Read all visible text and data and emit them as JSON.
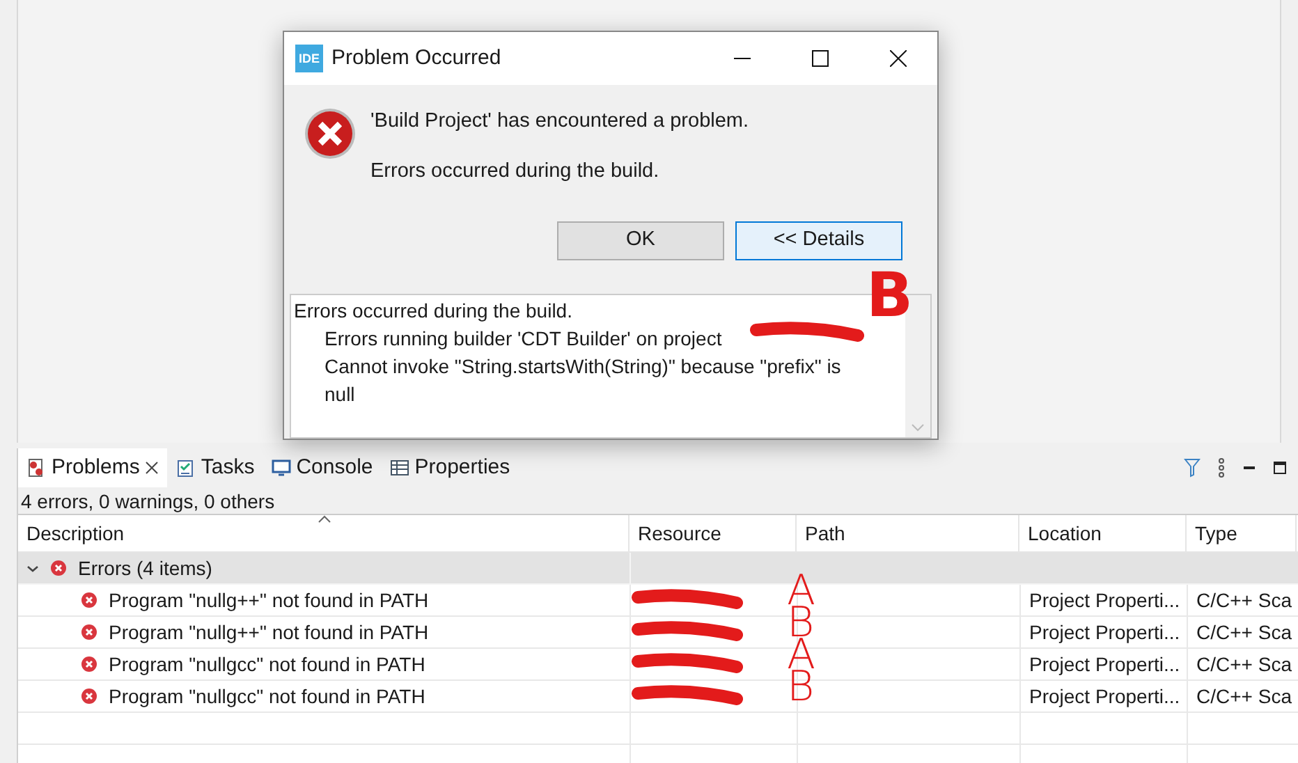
{
  "dialog": {
    "app_icon": "IDE",
    "title": "Problem Occurred",
    "message": "'Build Project' has encountered a problem.",
    "reason": "Errors occurred during the build.",
    "buttons": [
      {
        "label": "OK",
        "selected": false
      },
      {
        "label": "<< Details",
        "selected": true
      }
    ],
    "details": [
      "Errors occurred during the build.",
      "Errors running builder 'CDT Builder' on project",
      "Cannot invoke \"String.startsWith(String)\" because \"prefix\" is null"
    ]
  },
  "panel": {
    "tabs": [
      {
        "label": "Problems",
        "selected": true,
        "kind": "problems"
      },
      {
        "label": "Tasks",
        "selected": false,
        "kind": "tasks"
      },
      {
        "label": "Console",
        "selected": false,
        "kind": "console"
      },
      {
        "label": "Properties",
        "selected": false,
        "kind": "properties"
      }
    ],
    "summary": "4 errors, 0 warnings, 0 others",
    "columns": [
      "Description",
      "Resource",
      "Path",
      "Location",
      "Type"
    ],
    "group": {
      "label": "Errors (4 items)",
      "expanded": true
    },
    "rows": [
      {
        "description": "Program \"nullg++\" not found in PATH",
        "location": "Project Properti...",
        "type": "C/C++ Sca",
        "annotation": "A"
      },
      {
        "description": "Program \"nullg++\" not found in PATH",
        "location": "Project Properti...",
        "type": "C/C++ Sca",
        "annotation": "B"
      },
      {
        "description": "Program \"nullgcc\" not found in PATH",
        "location": "Project Properti...",
        "type": "C/C++ Sca",
        "annotation": "A"
      },
      {
        "description": "Program \"nullgcc\" not found in PATH",
        "location": "Project Properti...",
        "type": "C/C++ Sca",
        "annotation": "B"
      }
    ]
  },
  "dialog_annotation": "B"
}
